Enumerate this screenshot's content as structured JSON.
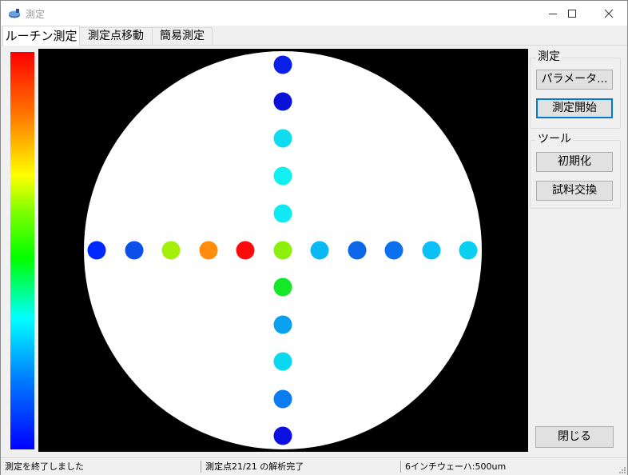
{
  "window": {
    "title": "測定",
    "icon": "wafer-app-icon",
    "controls": [
      "minimize-icon",
      "maximize-icon",
      "close-icon"
    ]
  },
  "tabs": [
    {
      "label": "ルーチン測定",
      "active": true
    },
    {
      "label": "測定点移動",
      "active": false
    },
    {
      "label": "簡易測定",
      "active": false
    }
  ],
  "groups": {
    "measure": {
      "label": "測定",
      "buttons": {
        "parameters": "パラメータ...",
        "start": "測定開始"
      }
    },
    "tools": {
      "label": "ツール",
      "buttons": {
        "init": "初期化",
        "swap": "試料交換"
      }
    }
  },
  "close_button": "閉じる",
  "status": {
    "message": "測定を終了しました",
    "progress": "測定点21/21 の解析完了",
    "wafer": "6インチウェーハ:500um"
  },
  "colors": {
    "wafer": "#ffffff",
    "background": "#000000",
    "accent_focus": "#0078d7"
  },
  "measurement_points": [
    {
      "color": "#0a20e8"
    },
    {
      "color": "#0a10d8"
    },
    {
      "color": "#10dcf0"
    },
    {
      "color": "#10f0f0"
    },
    {
      "color": "#10e8f4"
    },
    {
      "color": "#0028ff"
    },
    {
      "color": "#0a50e8"
    },
    {
      "color": "#a4f00a"
    },
    {
      "color": "#ff8c0a"
    },
    {
      "color": "#ff0a0a"
    },
    {
      "color": "#8cf00a"
    },
    {
      "color": "#0ab8f4"
    },
    {
      "color": "#0a68e8"
    },
    {
      "color": "#0a70f0"
    },
    {
      "color": "#0ac0f4"
    },
    {
      "color": "#0ad0f0"
    },
    {
      "color": "#14e828"
    },
    {
      "color": "#0aa0f0"
    },
    {
      "color": "#0ad8f0"
    },
    {
      "color": "#0a7cf0"
    },
    {
      "color": "#0a10e0"
    }
  ]
}
